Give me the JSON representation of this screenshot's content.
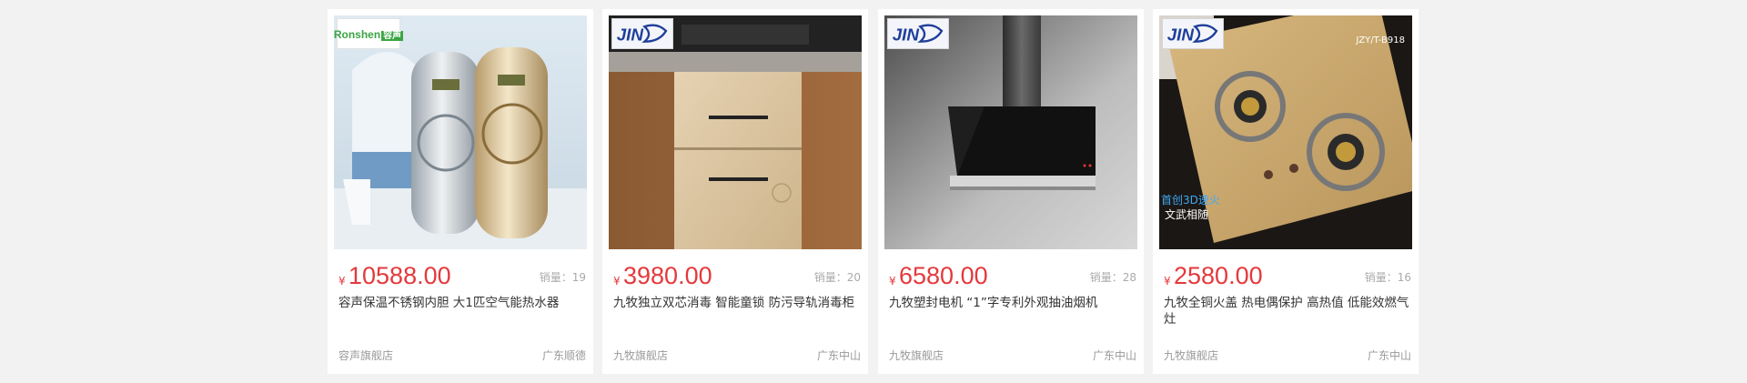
{
  "products": [
    {
      "brand_logo": "Ronshen容声",
      "logo_main": "Ronshen",
      "logo_tag": "容声",
      "currency": "¥",
      "price": "10588.00",
      "sales": "销量：19",
      "title": "容声保温不锈钢内胆 大1匹空气能热水器",
      "shop": "容声旗舰店",
      "location": "广东顺德",
      "image": "water-heater-image"
    },
    {
      "brand_logo": "JIUMU",
      "currency": "¥",
      "price": "3980.00",
      "sales": "销量：20",
      "title": "九牧独立双芯消毒 智能童锁 防污导轨消毒柜",
      "shop": "九牧旗舰店",
      "location": "广东中山",
      "image": "disinfection-cabinet-image"
    },
    {
      "brand_logo": "JIUMU",
      "currency": "¥",
      "price": "6580.00",
      "sales": "销量：28",
      "title": "九牧塑封电机 “1”字专利外观抽油烟机",
      "shop": "九牧旗舰店",
      "location": "广东中山",
      "image": "range-hood-image"
    },
    {
      "brand_logo": "JIUMU",
      "currency": "¥",
      "price": "2580.00",
      "sales": "销量：16",
      "title": "九牧全铜火盖 热电偶保护 高热值 低能效燃气灶",
      "shop": "九牧旗舰店",
      "location": "广东中山",
      "image": "gas-stove-image",
      "image_model": "JZY/T-B918",
      "image_caption_1": "首创3D速火",
      "image_caption_2": "文武相随"
    }
  ],
  "colors": {
    "price": "#e4393c",
    "muted": "#999999",
    "title": "#333333",
    "page_bg": "#f2f2f2"
  }
}
